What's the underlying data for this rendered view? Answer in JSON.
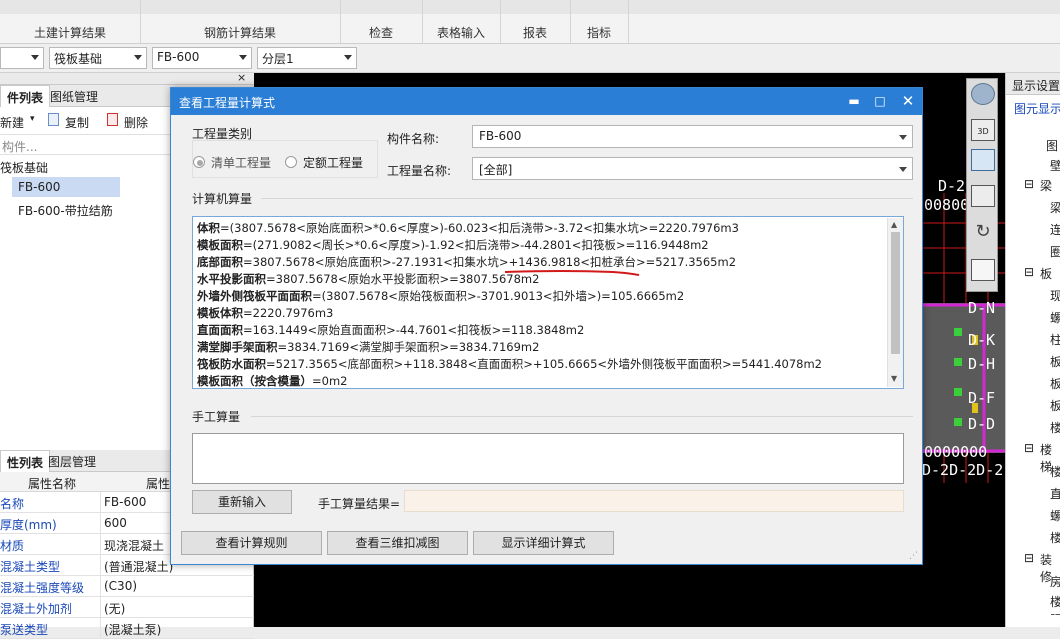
{
  "ribbon": {
    "groups": [
      "土建计算结果",
      "钢筋计算结果",
      "检查",
      "表格输入",
      "报表",
      "指标"
    ]
  },
  "selectors": {
    "type_value": "筏板基础",
    "component_value": "FB-600",
    "layer_value": "分层1"
  },
  "left_panel": {
    "tabs": [
      "件列表",
      "图纸管理"
    ],
    "toolbar": {
      "new_label": "新建",
      "copy_label": "复制",
      "delete_label": "删除"
    },
    "search_placeholder": "构件...",
    "tree": {
      "group": "筏板基础",
      "items": [
        "FB-600",
        "FB-600-带拉结筋"
      ]
    },
    "props_tabs": [
      "性列表",
      "图层管理"
    ],
    "props_header": {
      "name_col": "属性名称",
      "value_col": "属性"
    },
    "props": [
      {
        "name": "名称",
        "value": "FB-600"
      },
      {
        "name": "厚度(mm)",
        "value": "600"
      },
      {
        "name": "材质",
        "value": "现浇混凝土"
      },
      {
        "name": "混凝土类型",
        "value": "(普通混凝土)"
      },
      {
        "name": "混凝土强度等级",
        "value": "(C30)"
      },
      {
        "name": "混凝土外加剂",
        "value": "(无)"
      },
      {
        "name": "泵送类型",
        "value": "(混凝土泵)"
      }
    ]
  },
  "right_panel": {
    "title": "显示设置",
    "subtab": "图元显示",
    "rows": [
      "图",
      "壁",
      "梁",
      "梁",
      "连",
      "圈",
      "板",
      "现",
      "螺",
      "柱",
      "板",
      "板",
      "板",
      "楼",
      "楼梯",
      "楼",
      "直",
      "螺",
      "楼",
      "装修",
      "房",
      "楼",
      "踢"
    ]
  },
  "canvas": {
    "labels": [
      "D-2D-2",
      "0080008",
      "D-N",
      "D-K",
      "D-H",
      "D-F",
      "D-D",
      "0000000",
      "D-2D-2D-2"
    ]
  },
  "dialog": {
    "title": "查看工程量计算式",
    "qty_type_group": "工程量类别",
    "radio_list": "清单工程量",
    "radio_quota": "定额工程量",
    "component_name_label": "构件名称:",
    "component_name_value": "FB-600",
    "qty_name_label": "工程量名称:",
    "qty_name_value": "[全部]",
    "machine_calc_label": "计算机算量",
    "calc_lines": [
      {
        "name": "体积",
        "expr": "=(3807.5678<原始底面积>*0.6<厚度>)-60.023<扣后浇带>-3.72<扣集水坑>=2220.7976m3"
      },
      {
        "name": "模板面积",
        "expr": "=(271.9082<周长>*0.6<厚度>)-1.92<扣后浇带>-44.2801<扣筏板>=116.9448m2"
      },
      {
        "name": "底部面积",
        "expr": "=3807.5678<原始底面积>-27.1931<扣集水坑>+1436.9818<扣桩承台>=5217.3565m2"
      },
      {
        "name": "水平投影面积",
        "expr": "=3807.5678<原始水平投影面积>=3807.5678m2"
      },
      {
        "name": "外墙外侧筏板平面面积",
        "expr": "=(3807.5678<原始筏板面积>-3701.9013<扣外墙>)=105.6665m2"
      },
      {
        "name": "模板体积",
        "expr": "=2220.7976m3"
      },
      {
        "name": "直面面积",
        "expr": "=163.1449<原始直面面积>-44.7601<扣筏板>=118.3848m2"
      },
      {
        "name": "满堂脚手架面积",
        "expr": "=3834.7169<满堂脚手架面积>=3834.7169m2"
      },
      {
        "name": "筏板防水面积",
        "expr": "=5217.3565<底部面积>+118.3848<直面面积>+105.6665<外墙外侧筏板平面面积>=5441.4078m2"
      },
      {
        "name": "模板面积（按含模量）",
        "expr": "=0m2"
      }
    ],
    "manual_calc_label": "手工算量",
    "reinput_button": "重新输入",
    "manual_result_label": "手工算量结果=",
    "buttons": [
      "查看计算规则",
      "查看三维扣减图",
      "显示详细计算式"
    ]
  }
}
